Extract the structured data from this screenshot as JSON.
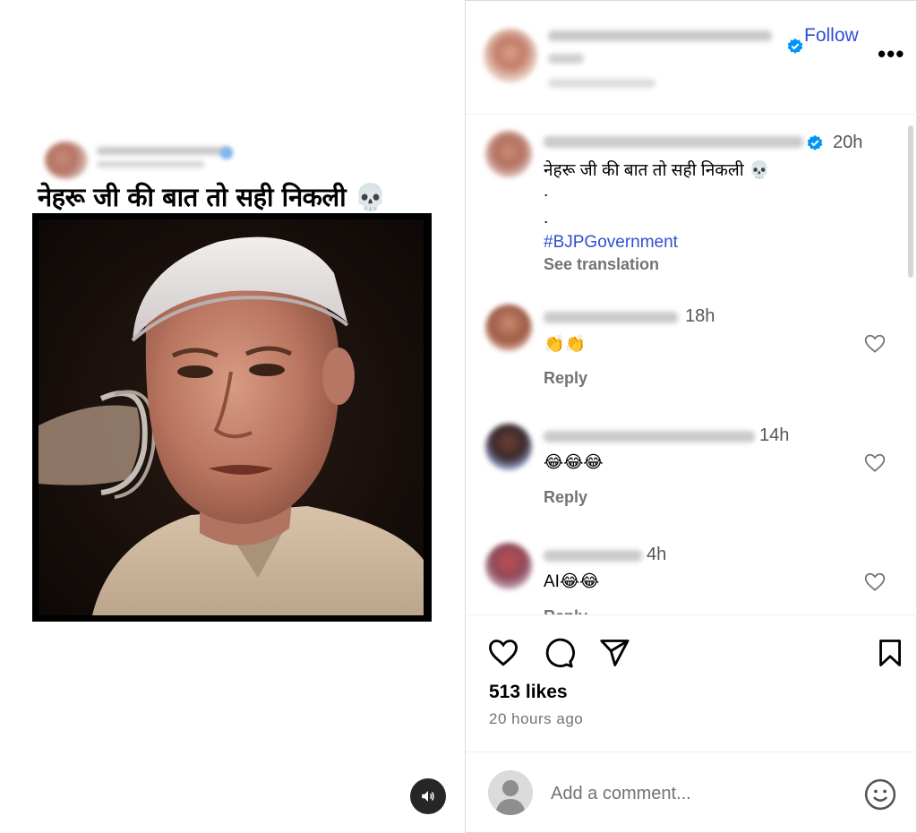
{
  "media": {
    "caption": "नेहरू जी की बात तो सही निकली 💀",
    "sound_icon": "speaker-icon"
  },
  "header": {
    "follow_label": "Follow",
    "more_label": "•••"
  },
  "post_caption": {
    "time": "20h",
    "text": "नेहरू जी की बात तो सही निकली 💀",
    "dot1": ".",
    "dot2": ".",
    "hashtag": "#BJPGovernment",
    "see_translation": "See translation"
  },
  "comments": [
    {
      "time": "18h",
      "text": "👏👏",
      "reply": "Reply"
    },
    {
      "time": "14h",
      "text": "😂😂😂",
      "reply": "Reply"
    },
    {
      "time": "4h",
      "text": "AI😂😂",
      "reply": "Reply"
    }
  ],
  "actions": {
    "likes": "513 likes",
    "time_ago": "20 hours ago",
    "comment_placeholder": "Add a comment..."
  },
  "colors": {
    "accent": "#2f4fd0",
    "verified": "#0095f6",
    "muted": "#737373"
  }
}
